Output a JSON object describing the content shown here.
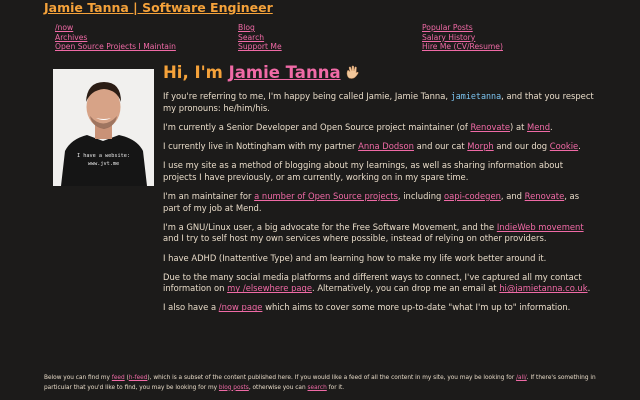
{
  "header": {
    "site_title": "Jamie Tanna | Software Engineer",
    "nav_col1": [
      "/now",
      "Archives",
      "Open Source Projects I Maintain"
    ],
    "nav_col2": [
      "Blog",
      "Search",
      "Support Me"
    ],
    "nav_col3": [
      "Popular Posts",
      "Salary History",
      "Hire Me (CV/Resume)"
    ]
  },
  "avatar": {
    "shirt_text_1": "I have a website:",
    "shirt_text_2": "www.jvt.me"
  },
  "intro": {
    "greeting": "Hi, I'm",
    "name": "Jamie Tanna",
    "wave_icon": "waving-hand-icon",
    "p1_a": "If you're referring to me, I'm happy being called Jamie, Jamie Tanna, ",
    "p1_code": "jamietanna",
    "p1_b": ", and that you respect my pronouns: he/him/his.",
    "p2_a": "I'm currently a Senior Developer and Open Source project maintainer (of ",
    "p2_link1": "Renovate",
    "p2_b": ") at ",
    "p2_link2": "Mend",
    "p2_c": ".",
    "p3_a": "I currently live in Nottingham with my partner ",
    "p3_link1": "Anna Dodson",
    "p3_b": " and our cat ",
    "p3_link2": "Morph",
    "p3_c": " and our dog ",
    "p3_link3": "Cookie",
    "p3_d": ".",
    "p4": "I use my site as a method of blogging about my learnings, as well as sharing information about projects I have previously, or am currently, working on in my spare time.",
    "p5_a": "I'm an maintainer for ",
    "p5_link1": "a number of Open Source projects",
    "p5_b": ", including ",
    "p5_link2": "oapi-codegen",
    "p5_c": ", and ",
    "p5_link3": "Renovate",
    "p5_d": ", as part of my job at Mend.",
    "p6_a": "I'm a GNU/Linux user, a big advocate for the Free Software Movement, and the ",
    "p6_link1": "IndieWeb movement",
    "p6_b": " and I try to self host my own services where possible, instead of relying on other providers.",
    "p7": "I have ADHD (Inattentive Type) and am learning how to make my life work better around it.",
    "p8_a": "Due to the many social media platforms and different ways to connect, I've captured all my contact information on ",
    "p8_link1": "my /elsewhere page",
    "p8_b": ". Alternatively, you can drop me an email at ",
    "p8_link2": "hi@jamietanna.co.uk",
    "p8_c": ".",
    "p9_a": "I also have a ",
    "p9_link1": "/now page",
    "p9_b": " which aims to cover some more up-to-date \"what I'm up to\" information."
  },
  "footer": {
    "a": "Below you can find my ",
    "link_feed": "feed",
    "b": " (",
    "link_hfeed": "h-feed",
    "c": "), which is a subset of the content published here. If you would like a feed of all the content in my site, you may be looking for ",
    "link_all": "/all/",
    "d": ". If there's something in particular that you'd like to find, you may be looking for my ",
    "link_posts": "blog posts",
    "e": ", otherwise you can ",
    "link_search": "search",
    "f": " for it."
  },
  "colors": {
    "background": "#1c1b1a",
    "text": "#e9dcc9",
    "accent_orange": "#f5a23a",
    "link_pink": "#f06aa6",
    "code_blue": "#7cc4f0"
  }
}
